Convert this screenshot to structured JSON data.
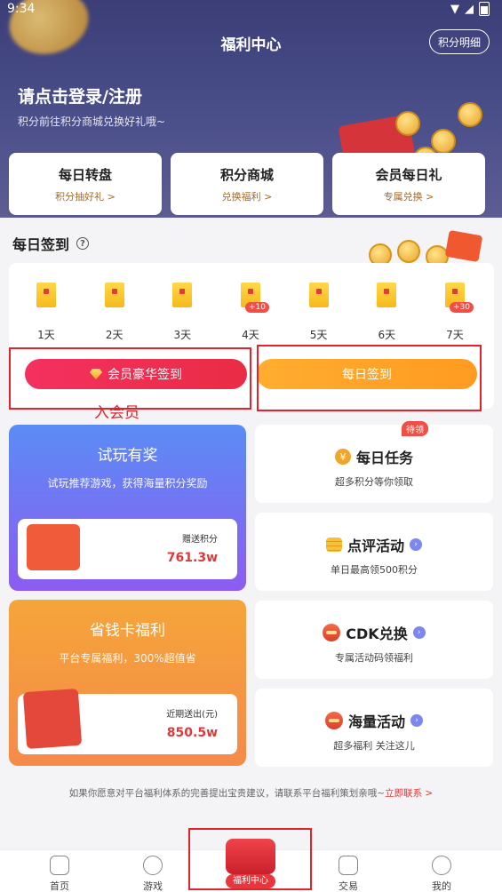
{
  "status": {
    "time": "9:34"
  },
  "header": {
    "title": "福利中心",
    "points_button": "积分明细",
    "login_title": "请点击登录/注册",
    "login_sub": "积分前往积分商城兑换好礼哦~"
  },
  "quick_cards": [
    {
      "title": "每日转盘",
      "sub": "积分抽好礼 >"
    },
    {
      "title": "积分商城",
      "sub": "兑换福利 >"
    },
    {
      "title": "会员每日礼",
      "sub": "专属兑换 >"
    }
  ],
  "sign_in": {
    "title": "每日签到",
    "days": [
      {
        "label": "1天",
        "bonus": ""
      },
      {
        "label": "2天",
        "bonus": ""
      },
      {
        "label": "3天",
        "bonus": ""
      },
      {
        "label": "4天",
        "bonus": "+10"
      },
      {
        "label": "5天",
        "bonus": ""
      },
      {
        "label": "6天",
        "bonus": ""
      },
      {
        "label": "7天",
        "bonus": "+30"
      }
    ],
    "vip_button": "会员豪华签到",
    "daily_button": "每日签到",
    "annotation": "入会员"
  },
  "features": {
    "trial": {
      "title": "试玩有奖",
      "sub": "试玩推荐游戏，获得海量积分奖励",
      "label": "赠送积分",
      "value": "761.3w"
    },
    "saver": {
      "title": "省钱卡福利",
      "sub": "平台专属福利，300%超值省",
      "label": "近期送出(元)",
      "value": "850.5w"
    },
    "tasks": {
      "title": "每日任务",
      "sub": "超多积分等你领取",
      "badge": "待领"
    },
    "review": {
      "title": "点评活动",
      "sub": "单日最高领500积分"
    },
    "cdk": {
      "title": "CDK兑换",
      "sub": "专属活动码领福利"
    },
    "mass": {
      "title": "海量活动",
      "sub": "超多福利 关注这儿"
    }
  },
  "footer": {
    "note": "如果你愿意对平台福利体系的完善提出宝贵建议，请联系平台福利策划亲哦~",
    "link": "立即联系 >"
  },
  "tabs": [
    {
      "label": "首页"
    },
    {
      "label": "游戏"
    },
    {
      "label": "福利中心"
    },
    {
      "label": "交易"
    },
    {
      "label": "我的"
    }
  ]
}
